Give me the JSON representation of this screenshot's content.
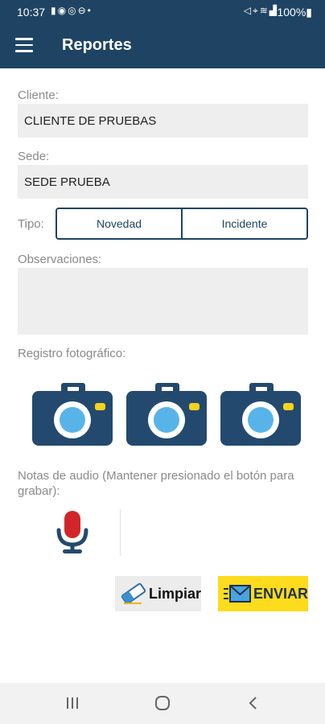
{
  "status_bar": {
    "time": "10:37",
    "battery": "100%",
    "left_icons": [
      "sim-card-icon",
      "facebook-messenger-icon",
      "whatsapp-icon",
      "do-not-disturb-icon",
      "notification-dot-icon"
    ],
    "right_icons": [
      "mute-icon",
      "location-icon",
      "wifi-icon",
      "signal-icon",
      "battery-icon"
    ]
  },
  "app_bar": {
    "title": "Reportes",
    "menu_icon": "menu-icon"
  },
  "form": {
    "cliente_label": "Cliente:",
    "cliente_value": "CLIENTE DE PRUEBAS",
    "sede_label": "Sede:",
    "sede_value": "SEDE PRUEBA",
    "tipo_label": "Tipo:",
    "tipo_options": [
      "Novedad",
      "Incidente"
    ],
    "observaciones_label": "Observaciones:",
    "observaciones_value": "",
    "registro_label": "Registro fotográfico:",
    "audio_label": "Notas de audio (Mantener presionado el botón para grabar):"
  },
  "buttons": {
    "limpiar": "Limpiar",
    "enviar": "ENVIAR"
  },
  "colors": {
    "primary": "#1f4463",
    "camera_blue": "#234a6e",
    "lens": "#58b4e8",
    "flash": "#f6d21c",
    "mic_red": "#d2252a",
    "enviar_bg": "#fddb1d",
    "field_bg": "#eeeeee"
  }
}
